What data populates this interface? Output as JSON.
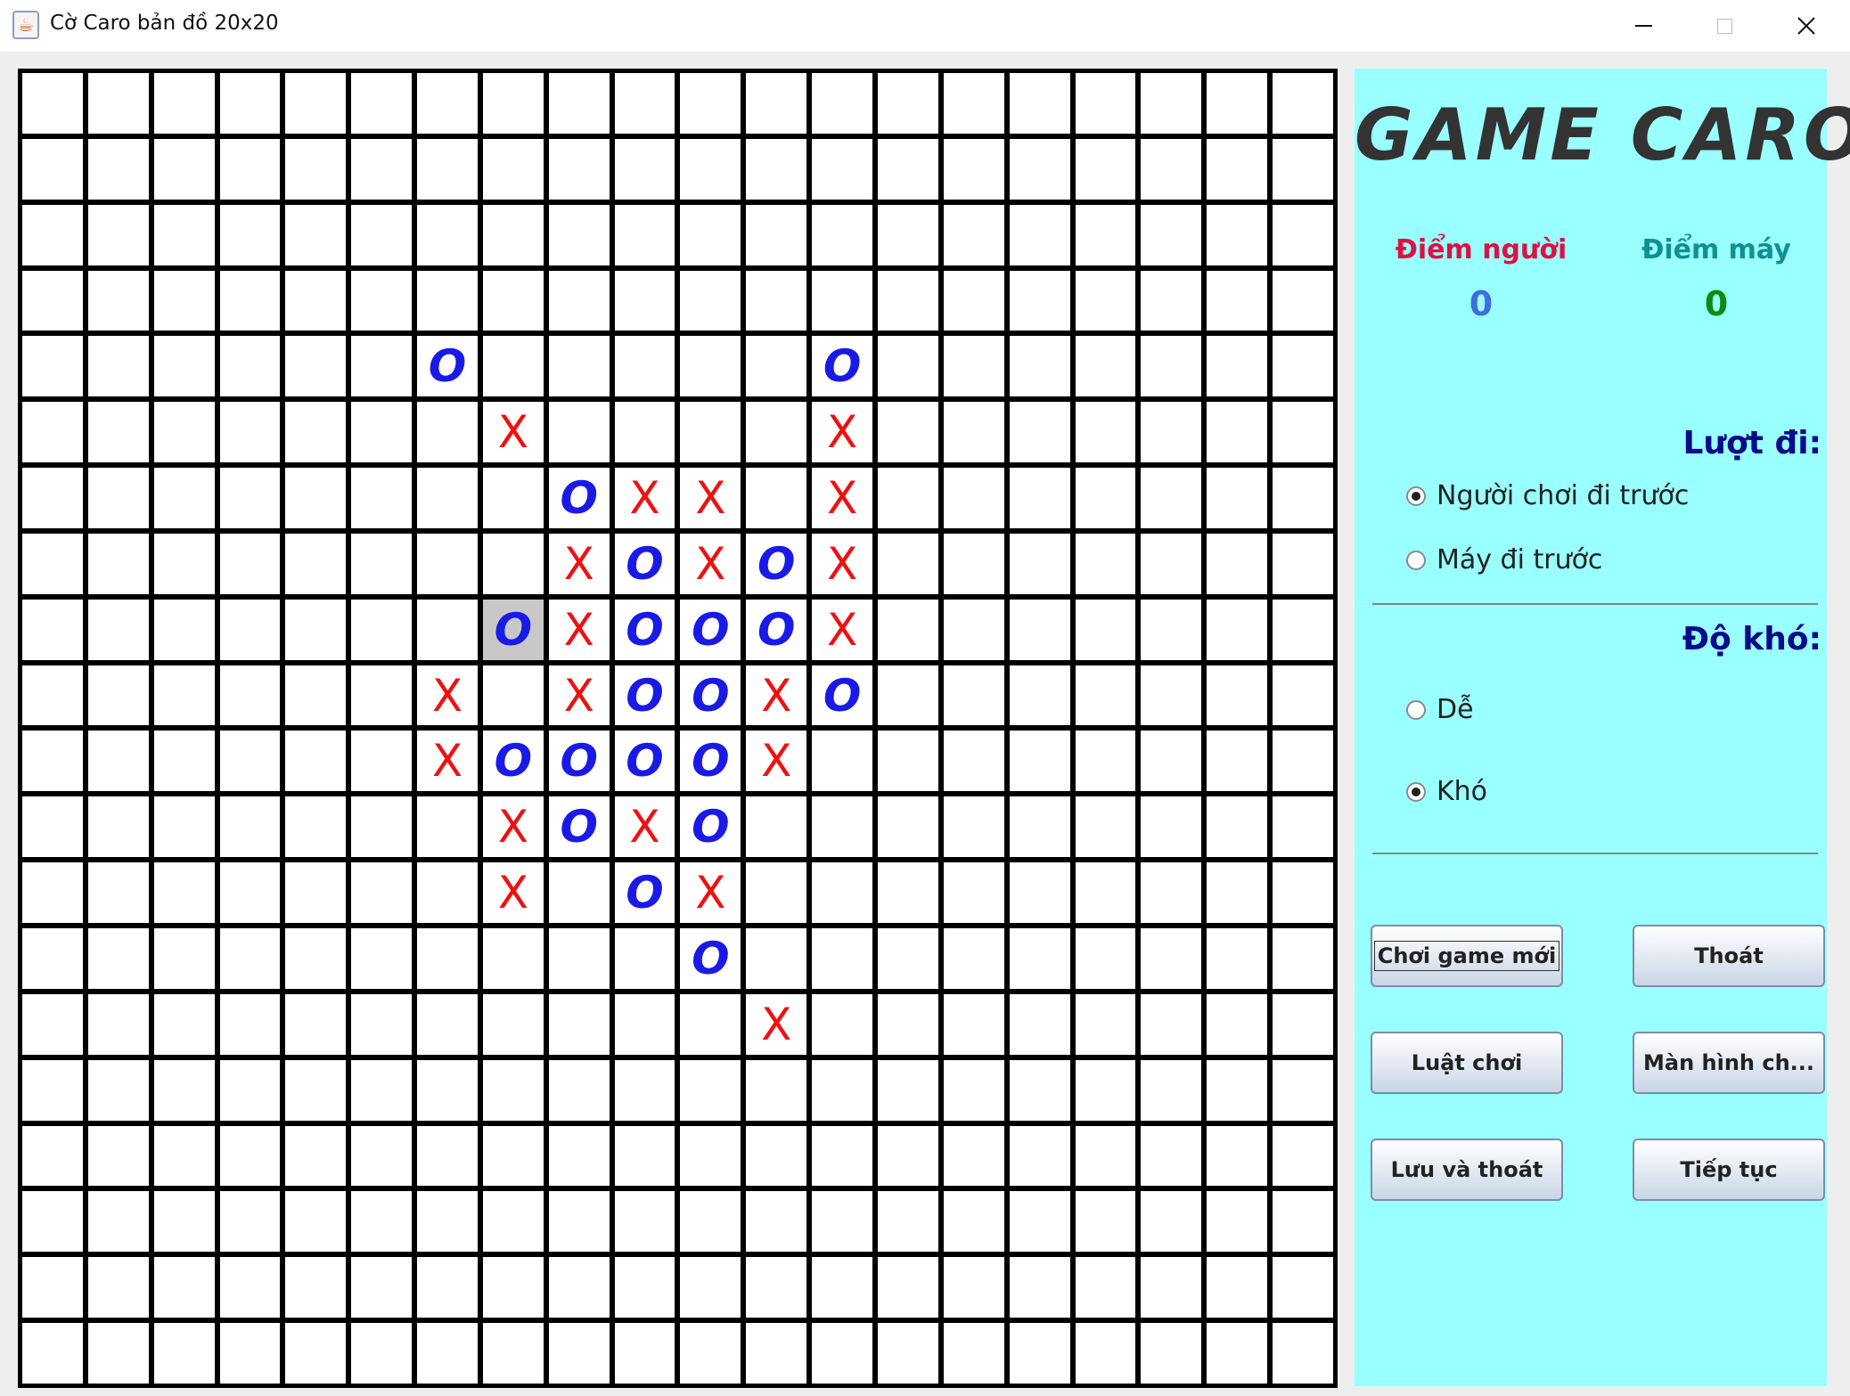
{
  "window": {
    "title": "Cờ Caro bản đồ 20x20",
    "app_icon": "java-cup-icon"
  },
  "board": {
    "size": 20,
    "highlight": {
      "row": 8,
      "col": 7
    },
    "marks": [
      {
        "r": 4,
        "c": 6,
        "m": "O"
      },
      {
        "r": 4,
        "c": 12,
        "m": "O"
      },
      {
        "r": 5,
        "c": 7,
        "m": "X"
      },
      {
        "r": 5,
        "c": 12,
        "m": "X"
      },
      {
        "r": 6,
        "c": 8,
        "m": "O"
      },
      {
        "r": 6,
        "c": 9,
        "m": "X"
      },
      {
        "r": 6,
        "c": 10,
        "m": "X"
      },
      {
        "r": 6,
        "c": 12,
        "m": "X"
      },
      {
        "r": 7,
        "c": 8,
        "m": "X"
      },
      {
        "r": 7,
        "c": 9,
        "m": "O"
      },
      {
        "r": 7,
        "c": 10,
        "m": "X"
      },
      {
        "r": 7,
        "c": 11,
        "m": "O"
      },
      {
        "r": 7,
        "c": 12,
        "m": "X"
      },
      {
        "r": 8,
        "c": 7,
        "m": "O"
      },
      {
        "r": 8,
        "c": 8,
        "m": "X"
      },
      {
        "r": 8,
        "c": 9,
        "m": "O"
      },
      {
        "r": 8,
        "c": 10,
        "m": "O"
      },
      {
        "r": 8,
        "c": 11,
        "m": "O"
      },
      {
        "r": 8,
        "c": 12,
        "m": "X"
      },
      {
        "r": 9,
        "c": 6,
        "m": "X"
      },
      {
        "r": 9,
        "c": 8,
        "m": "X"
      },
      {
        "r": 9,
        "c": 9,
        "m": "O"
      },
      {
        "r": 9,
        "c": 10,
        "m": "O"
      },
      {
        "r": 9,
        "c": 11,
        "m": "X"
      },
      {
        "r": 9,
        "c": 12,
        "m": "O"
      },
      {
        "r": 10,
        "c": 6,
        "m": "X"
      },
      {
        "r": 10,
        "c": 7,
        "m": "O"
      },
      {
        "r": 10,
        "c": 8,
        "m": "O"
      },
      {
        "r": 10,
        "c": 9,
        "m": "O"
      },
      {
        "r": 10,
        "c": 10,
        "m": "O"
      },
      {
        "r": 10,
        "c": 11,
        "m": "X"
      },
      {
        "r": 11,
        "c": 7,
        "m": "X"
      },
      {
        "r": 11,
        "c": 8,
        "m": "O"
      },
      {
        "r": 11,
        "c": 9,
        "m": "X"
      },
      {
        "r": 11,
        "c": 10,
        "m": "O"
      },
      {
        "r": 12,
        "c": 7,
        "m": "X"
      },
      {
        "r": 12,
        "c": 9,
        "m": "O"
      },
      {
        "r": 12,
        "c": 10,
        "m": "X"
      },
      {
        "r": 13,
        "c": 10,
        "m": "O"
      },
      {
        "r": 14,
        "c": 11,
        "m": "X"
      }
    ]
  },
  "panel": {
    "title": "GAME CARO",
    "player_score_label": "Điểm người",
    "machine_score_label": "Điểm máy",
    "player_score": "0",
    "machine_score": "0",
    "turn_label": "Lượt đi:",
    "turn_options": [
      {
        "label": "Người chơi đi trước",
        "selected": true
      },
      {
        "label": "Máy đi trước",
        "selected": false
      }
    ],
    "difficulty_label": "Độ khó:",
    "difficulty_options": [
      {
        "label": "Dễ",
        "selected": false
      },
      {
        "label": "Khó",
        "selected": true
      }
    ],
    "buttons": {
      "new_game": "Chơi game mới",
      "exit": "Thoát",
      "rules": "Luật chơi",
      "main_screen": "Màn hình ch...",
      "save_exit": "Lưu và thoát",
      "continue": "Tiếp tục"
    }
  },
  "colors": {
    "panel_bg": "#99ffff",
    "x_mark": "#ee1111",
    "o_mark": "#1a1ae6",
    "player_label": "#dd1144",
    "machine_label": "#109090",
    "section_head": "#0a0a8a"
  }
}
